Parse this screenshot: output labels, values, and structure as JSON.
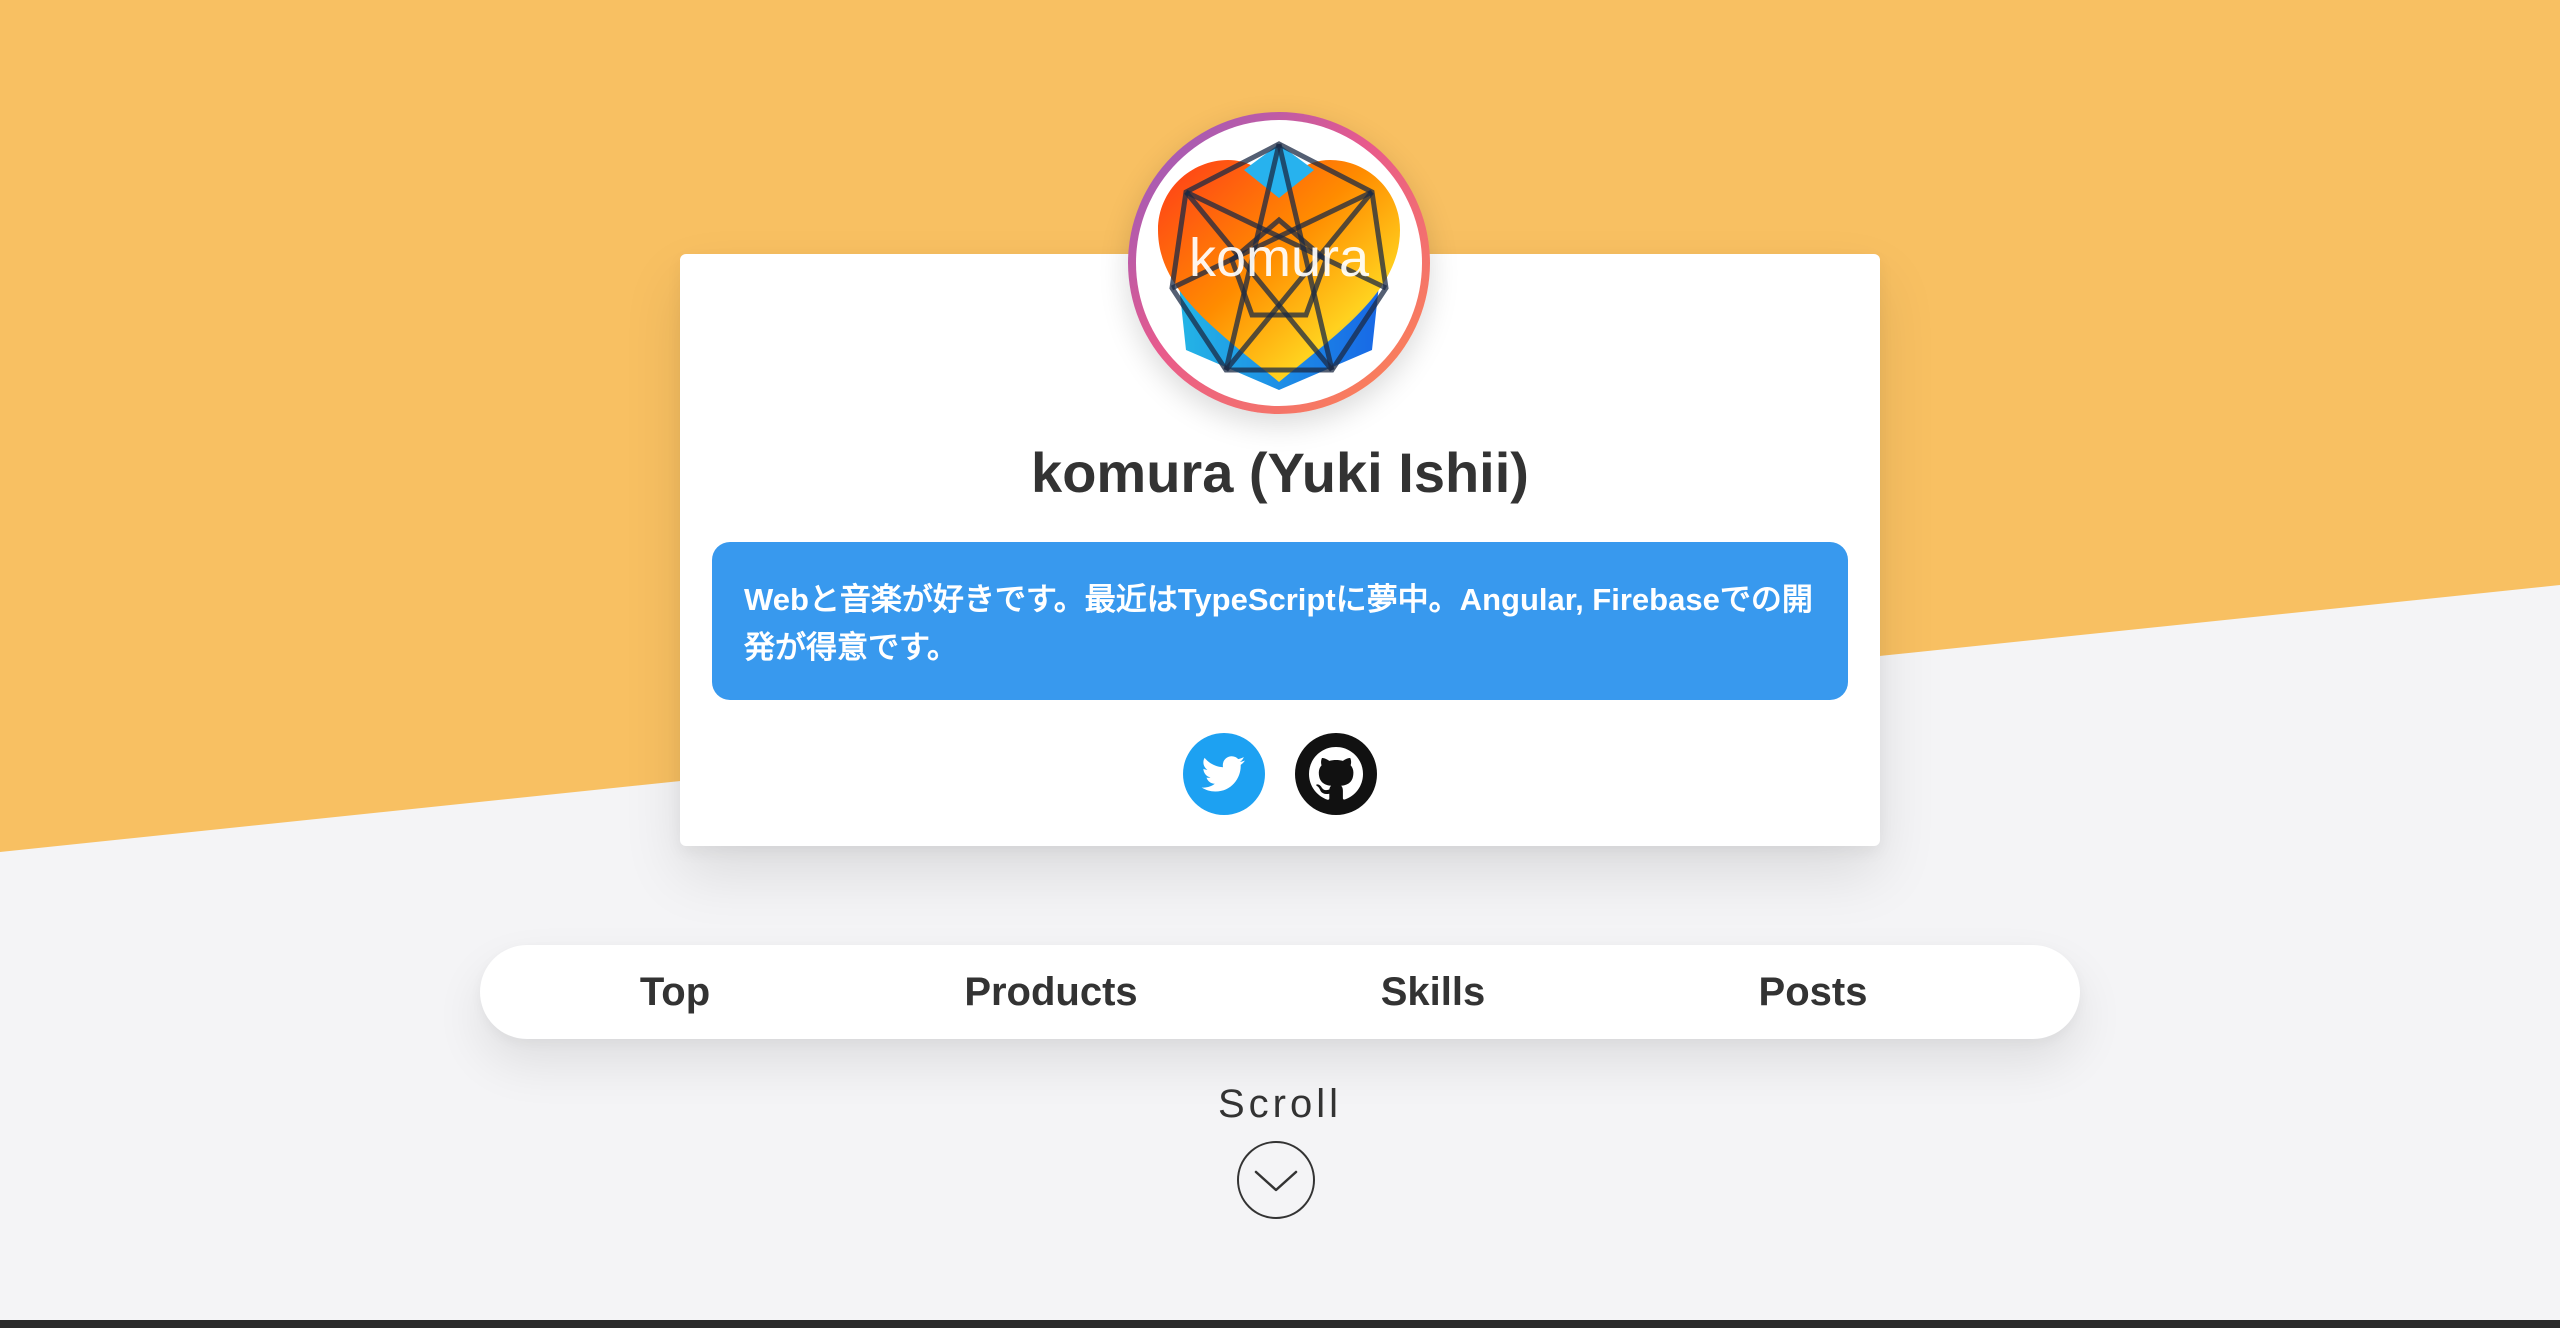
{
  "colors": {
    "background_top": "#f8c062",
    "background_bottom": "#f4f4f6",
    "bio_background": "#3899ee",
    "twitter_blue": "#1da1f2",
    "text_dark": "#333333"
  },
  "profile": {
    "avatar_text": "komura",
    "name": "komura (Yuki Ishii)",
    "bio": "Webと音楽が好きです。最近はTypeScriptに夢中。Angular, Firebaseでの開発が得意です。"
  },
  "social": {
    "twitter_icon": "twitter-bird-icon",
    "github_icon": "github-octocat-icon"
  },
  "nav": {
    "items": [
      {
        "label": "Top"
      },
      {
        "label": "Products"
      },
      {
        "label": "Skills"
      },
      {
        "label": "Posts"
      }
    ]
  },
  "scroll": {
    "label": "Scroll",
    "icon": "chevron-down-circle-icon"
  }
}
